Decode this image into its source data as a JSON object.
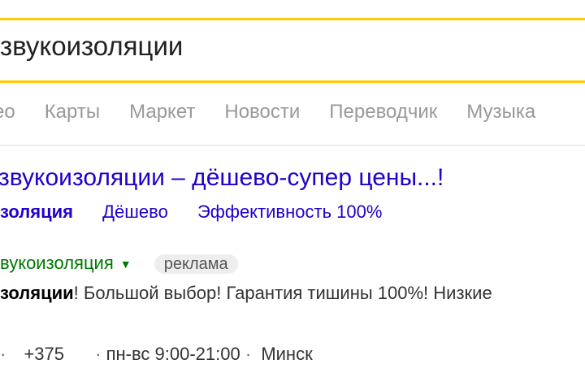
{
  "search": {
    "query": "звукоизоляции",
    "clear_icon": "clear-icon"
  },
  "tabs": [
    {
      "label": "део"
    },
    {
      "label": "Карты"
    },
    {
      "label": "Маркет"
    },
    {
      "label": "Новости"
    },
    {
      "label": "Переводчик"
    },
    {
      "label": "Музыка"
    }
  ],
  "result": {
    "title": "звукоизоляции – дёшево-супер цены...!",
    "sitelinks": [
      {
        "label": "золяция"
      },
      {
        "label": "Дёшево"
      },
      {
        "label": "Эффективность 100%"
      }
    ],
    "url_text": "вукоизоляция",
    "ad_label": "реклама",
    "snippet_bold": "золяции",
    "snippet_rest": "! Большой выбор! Гарантия тишины 100%! Низкие",
    "contacts": {
      "sep1": "·",
      "phone": "+375",
      "sep2": "·",
      "hours": "пн-вс 9:00-21:00",
      "sep3": "·",
      "city": "Минск"
    }
  },
  "colors": {
    "search_border": "#ffcc00",
    "link": "#2200cc",
    "url": "#007700",
    "tab_text": "#999999"
  }
}
